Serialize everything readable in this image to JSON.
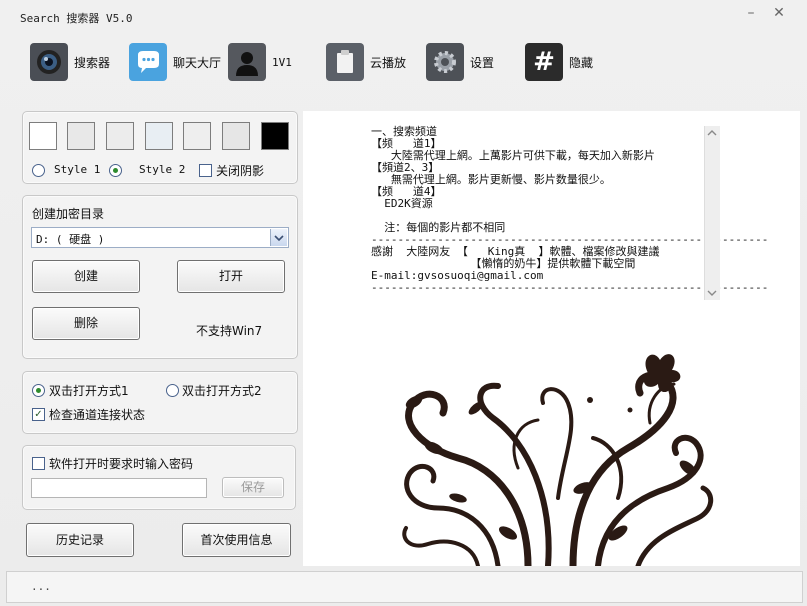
{
  "window": {
    "title": "Search 搜索器 V5.0"
  },
  "toolbar": [
    {
      "label": "搜索器",
      "icon": "camera-lens-icon"
    },
    {
      "label": "聊天大厅",
      "icon": "chat-bubble-icon"
    },
    {
      "label": "1V1",
      "icon": "user-silhouette-icon"
    },
    {
      "label": "云播放",
      "icon": "clipboard-icon"
    },
    {
      "label": "设置",
      "icon": "gear-icon"
    },
    {
      "label": "隐藏",
      "icon": "hash-icon"
    }
  ],
  "style_panel": {
    "swatch_colors": [
      "#ffffff",
      "#e8e8e8",
      "#ececec",
      "#e8eef3",
      "#eeeeee",
      "#e6e6e6",
      "#000000"
    ],
    "style1": "Style 1",
    "style2": "Style 2",
    "shadow_off": "关闭阴影",
    "selected_style": "Style 2"
  },
  "encrypt_panel": {
    "title": "创建加密目录",
    "drive_value": "D: ( 硬盘 )",
    "create_btn": "创建",
    "open_btn": "打开",
    "delete_btn": "删除",
    "note": "不支持Win7"
  },
  "open_mode_panel": {
    "mode1": "双击打开方式1",
    "mode2": "双击打开方式2",
    "check_connection": "检查通道连接状态",
    "selected_mode": "双击打开方式1",
    "check_connection_checked": true
  },
  "password_panel": {
    "require_password": "软件打开时要求时输入密码",
    "password_value": "",
    "save_btn": "保存"
  },
  "bottom_buttons": {
    "history": "历史记录",
    "first_use": "首次使用信息"
  },
  "info_text": {
    "lines": [
      "一、搜索频道",
      "【频   道1】",
      "   大陸需代理上網。上萬影片可供下載，每天加入新影片",
      "【頻道2、3】",
      "   無需代理上網。影片更新慢、影片数量很少。",
      "【频   道4】",
      "  ED2K資源",
      "",
      "  注：每個的影片都不相同",
      "------------------------------------------------------------",
      "感謝  大陸网友 【   King真  】軟體、檔案修改與建議",
      "               【懶惰的奶牛】提供軟體下載空間",
      "E-mail:gvsosuoqi@gmail.com",
      "------------------------------------------------------------"
    ]
  },
  "status": {
    "text": "..."
  }
}
